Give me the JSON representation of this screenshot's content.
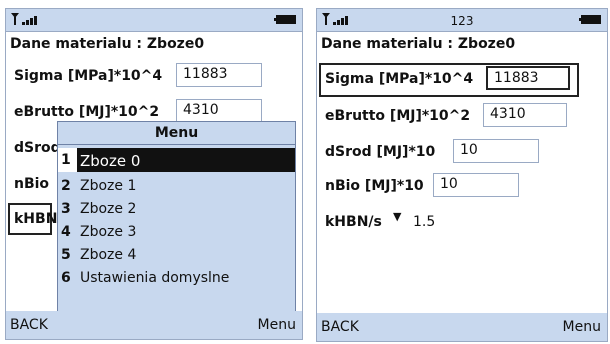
{
  "left_phone": {
    "title": "Dane materialu : Zboze0",
    "fields": [
      {
        "label": "Sigma [MPa]*10^4",
        "value": "11883"
      },
      {
        "label": "eBrutto [MJ]*10^2",
        "value": "4310"
      },
      {
        "label": "dSrod",
        "value": ""
      },
      {
        "label": "nBio",
        "value": ""
      },
      {
        "label": "kHBN",
        "value": ""
      }
    ],
    "menu": {
      "title": "Menu",
      "items": [
        {
          "num": "1",
          "label": "Zboze 0"
        },
        {
          "num": "2",
          "label": "Zboze 1"
        },
        {
          "num": "3",
          "label": "Zboze 2"
        },
        {
          "num": "4",
          "label": "Zboze 3"
        },
        {
          "num": "5",
          "label": "Zboze 4"
        },
        {
          "num": "6",
          "label": "Ustawienia domyslne"
        }
      ]
    },
    "softkeys": {
      "left": "BACK",
      "right": "Menu"
    }
  },
  "right_phone": {
    "status_text": "123",
    "title": "Dane materialu : Zboze0",
    "fields": [
      {
        "label": "Sigma [MPa]*10^4",
        "value": "11883"
      },
      {
        "label": "eBrutto [MJ]*10^2",
        "value": "4310"
      },
      {
        "label": "dSrod [MJ]*10",
        "value": "10"
      },
      {
        "label": "nBio [MJ]*10",
        "value": "10"
      },
      {
        "label": "kHBN/s",
        "value": "1.5",
        "icon": "down-arrow-icon"
      }
    ],
    "softkeys": {
      "left": "BACK",
      "right": "Menu"
    }
  },
  "colors": {
    "screen_bg": "#c8d8ee",
    "selection": "#111111"
  },
  "icons": [
    "signal-strength-icon",
    "battery-icon"
  ]
}
